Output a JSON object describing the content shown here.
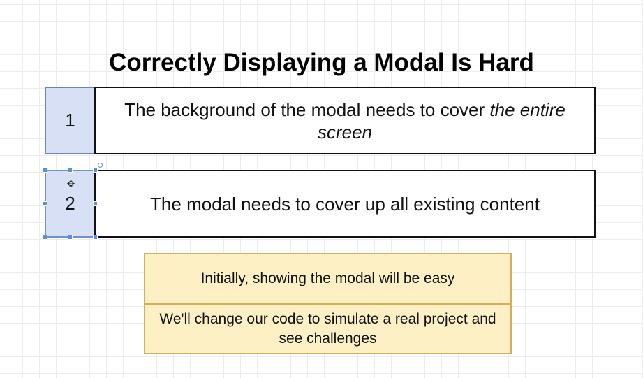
{
  "title": "Correctly Displaying a Modal Is Hard",
  "rows": [
    {
      "number": "1",
      "text_plain": "The background of the modal needs to cover ",
      "text_emphasis": "the entire screen"
    },
    {
      "number": "2",
      "text_plain": "The modal needs to cover up all existing content"
    }
  ],
  "notes": [
    "Initially, showing the modal will be easy",
    "We'll change our code to simulate a real project and see challenges"
  ],
  "colors": {
    "number_box_fill": "#d8e0f6",
    "number_box_border": "#6a84bf",
    "note_fill": "#fdf0c4",
    "note_border": "#d6ae5a",
    "selection_handle": "#5e8fd6"
  },
  "icons": {
    "rotate_handle": "rotate-handle-icon",
    "move_cursor": "move-cursor-icon"
  }
}
